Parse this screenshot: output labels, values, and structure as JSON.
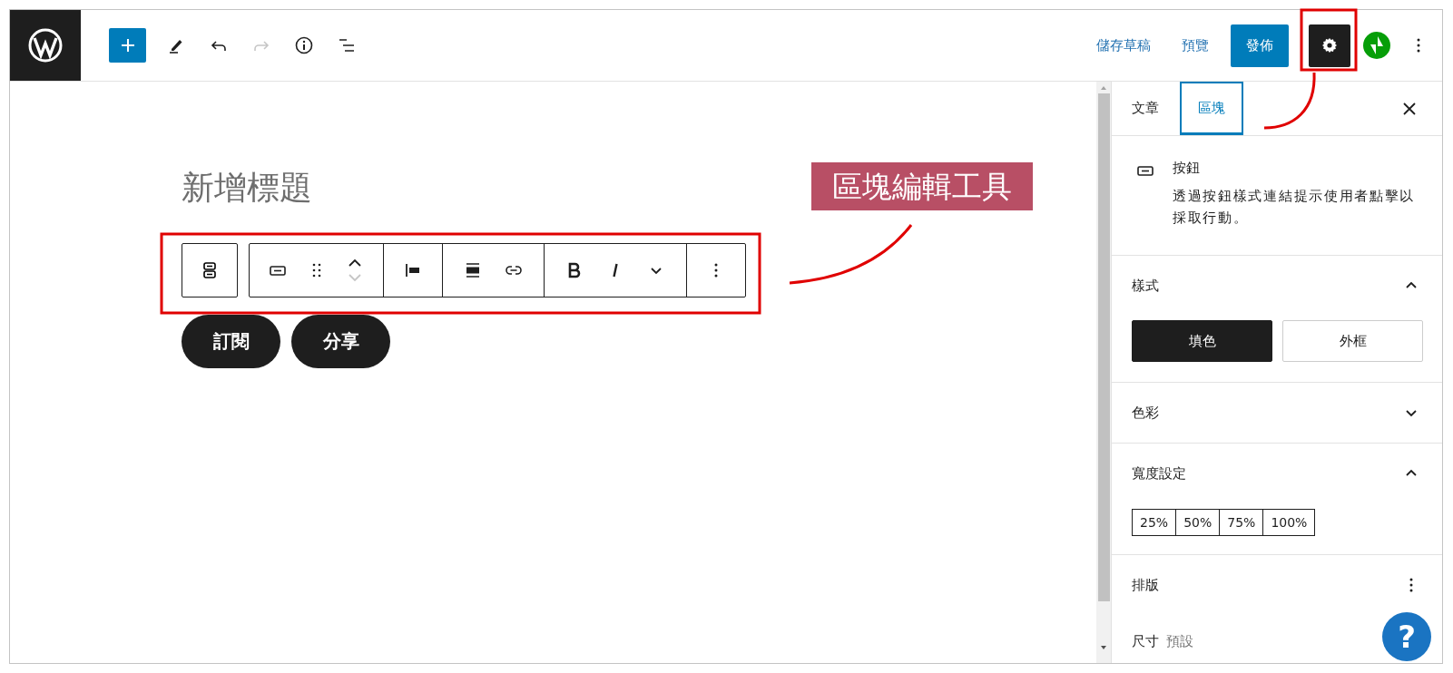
{
  "top_bar": {
    "redo_disabled": true,
    "save_draft": "儲存草稿",
    "preview": "預覽",
    "publish": "發佈",
    "settings_selected": true
  },
  "editor": {
    "title_placeholder": "新增標題",
    "block_toolbar": {
      "move_up_disabled": false,
      "move_down_disabled": true
    },
    "buttons": [
      "訂閱",
      "分享"
    ]
  },
  "annotation": {
    "label": "區塊編輯工具"
  },
  "sidebar": {
    "tabs": [
      {
        "label": "文章",
        "selected": false
      },
      {
        "label": "區塊",
        "selected": true
      }
    ],
    "block": {
      "name": "按鈕",
      "description": "透過按鈕樣式連結提示使用者點擊以採取行動。"
    },
    "panels": [
      {
        "kind": "styles",
        "title": "樣式",
        "expanded": true,
        "options": [
          {
            "label": "填色",
            "selected": true
          },
          {
            "label": "外框",
            "selected": false
          }
        ]
      },
      {
        "kind": "styles",
        "title": "色彩",
        "expanded": false
      },
      {
        "kind": "widths",
        "title": "寬度設定",
        "expanded": true,
        "options": [
          {
            "label": "25%",
            "selected": false
          },
          {
            "label": "50%",
            "selected": false
          },
          {
            "label": "75%",
            "selected": false
          },
          {
            "label": "100%",
            "selected": false
          }
        ]
      },
      {
        "kind": "menu",
        "title": "排版",
        "rows": [
          {
            "label": "尺寸",
            "value": "預設"
          }
        ]
      }
    ]
  },
  "help": "?"
}
